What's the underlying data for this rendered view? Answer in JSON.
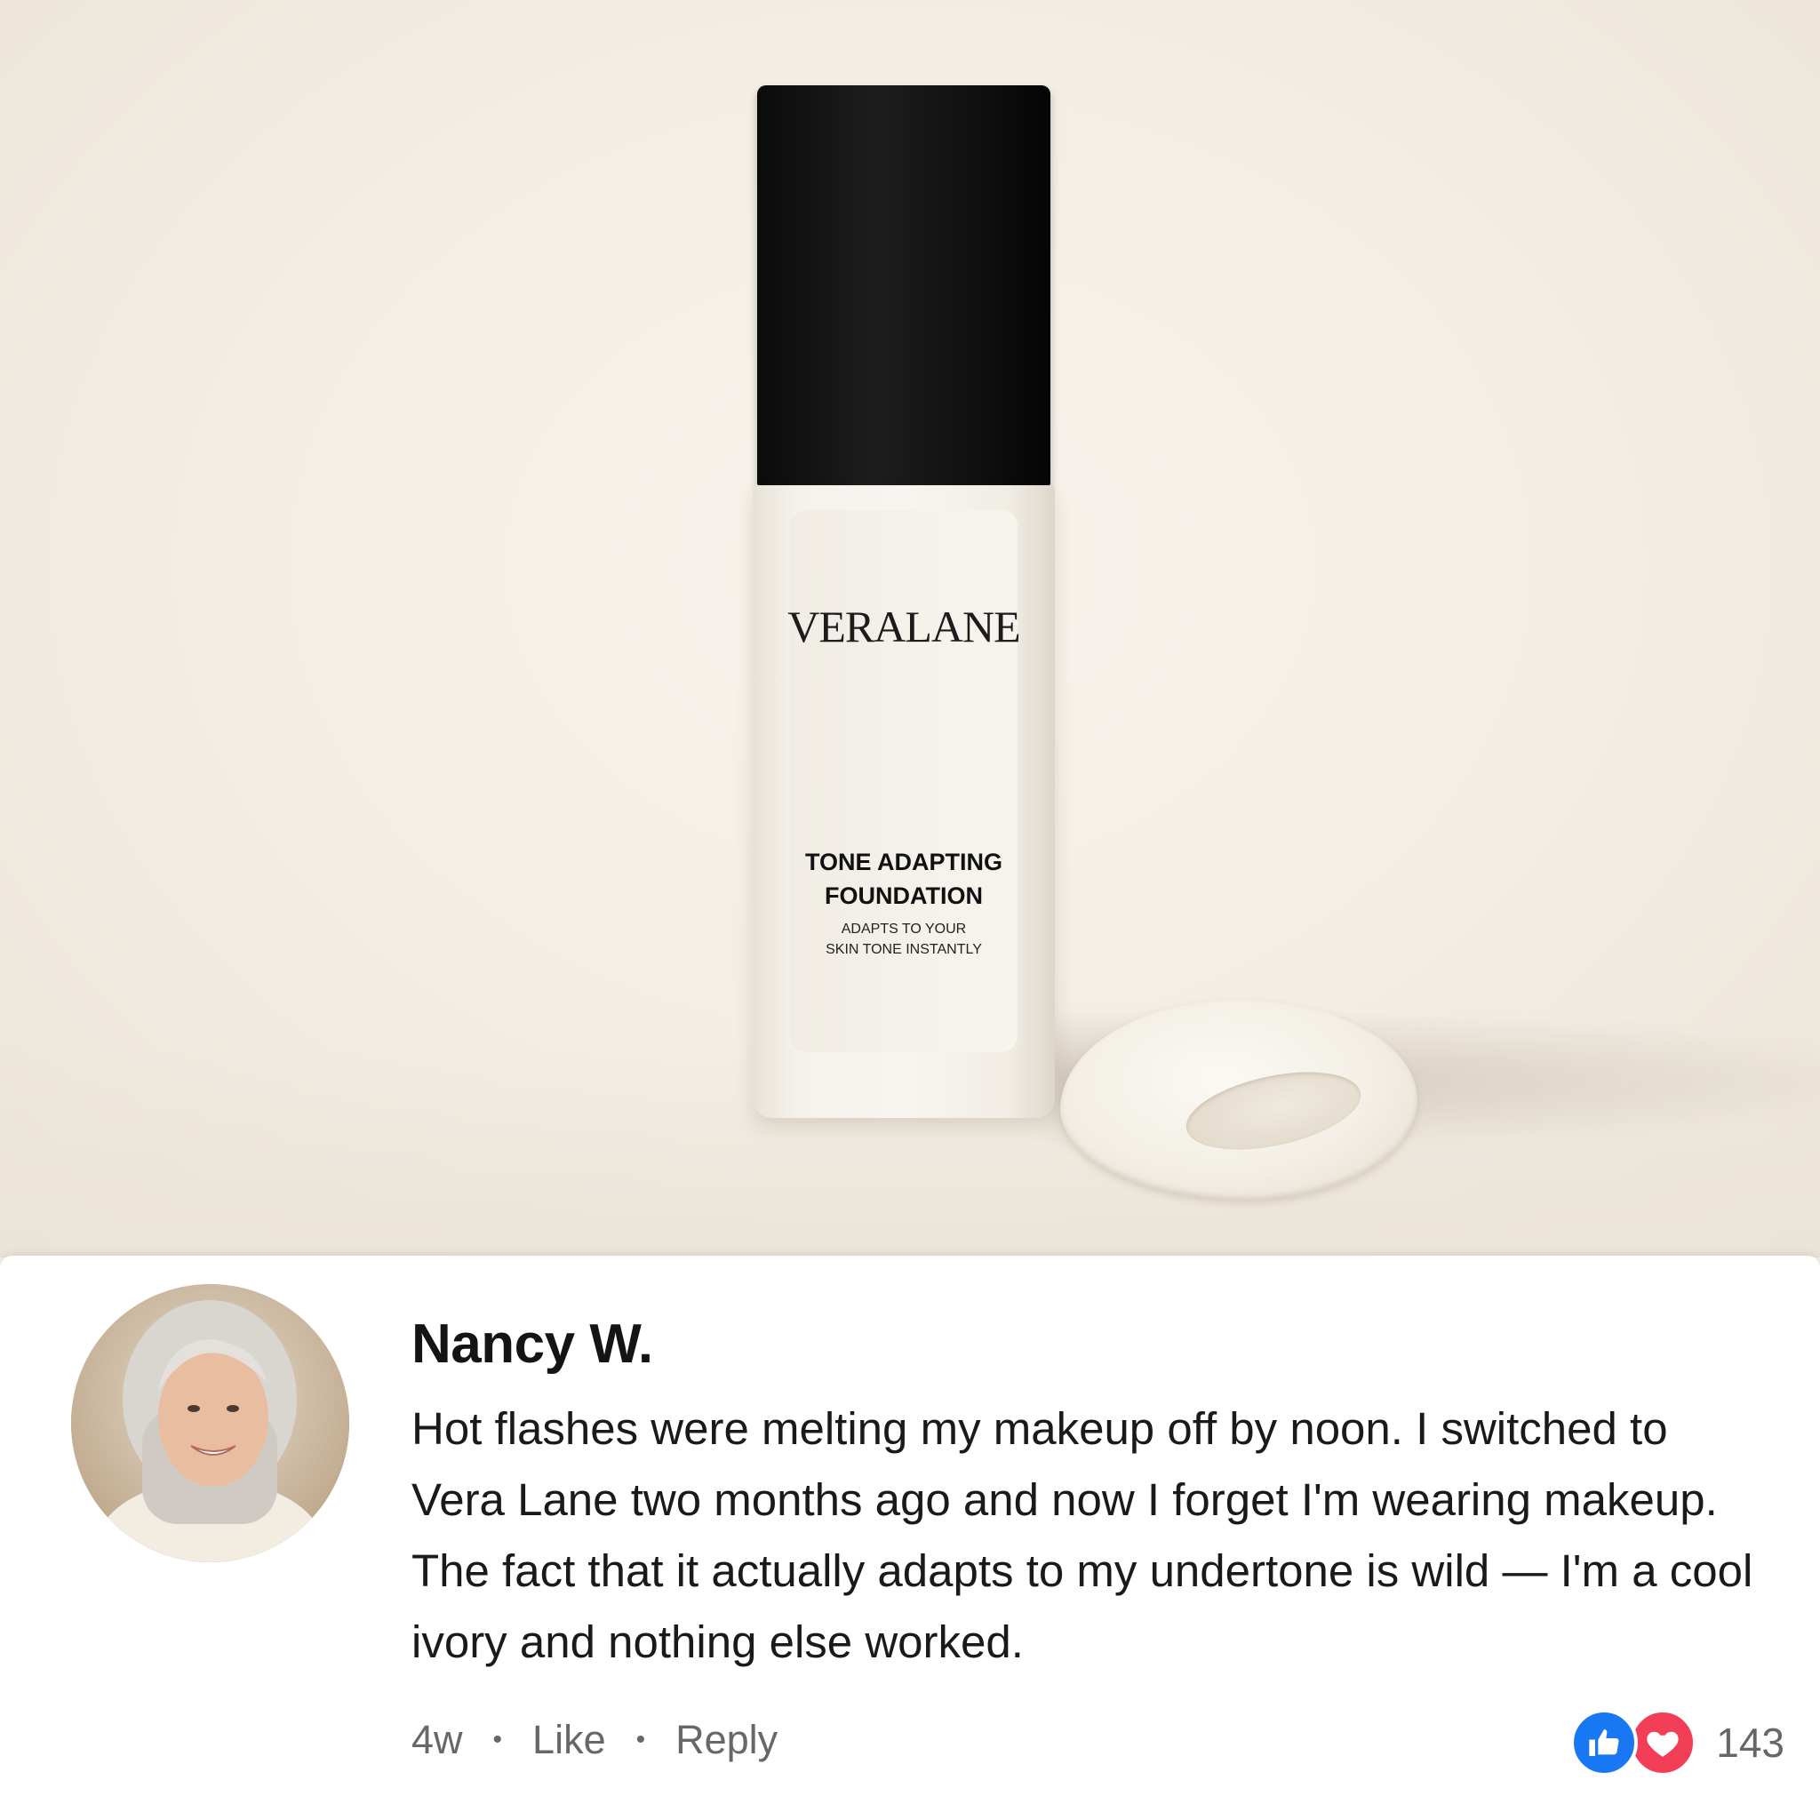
{
  "product": {
    "brand": "VERALANE",
    "name_line1": "TONE ADAPTING",
    "name_line2": "FOUNDATION",
    "sub_line1": "ADAPTS TO YOUR",
    "sub_line2": "SKIN TONE INSTANTLY"
  },
  "comment": {
    "author": "Nancy W.",
    "text": "Hot flashes were melting my makeup off by noon. I switched to Vera Lane two months ago and now I forget I'm wearing makeup. The fact that it actually adapts to my undertone is wild — I'm a cool ivory and nothing else worked.",
    "time": "4w",
    "separator": "•",
    "like_label": "Like",
    "reply_label": "Reply",
    "reaction_count": "143",
    "reaction_icons": [
      "like-icon",
      "heart-icon"
    ]
  },
  "colors": {
    "like_blue": "#1877f2",
    "love_red": "#f33e58",
    "meta_gray": "#65676b"
  }
}
